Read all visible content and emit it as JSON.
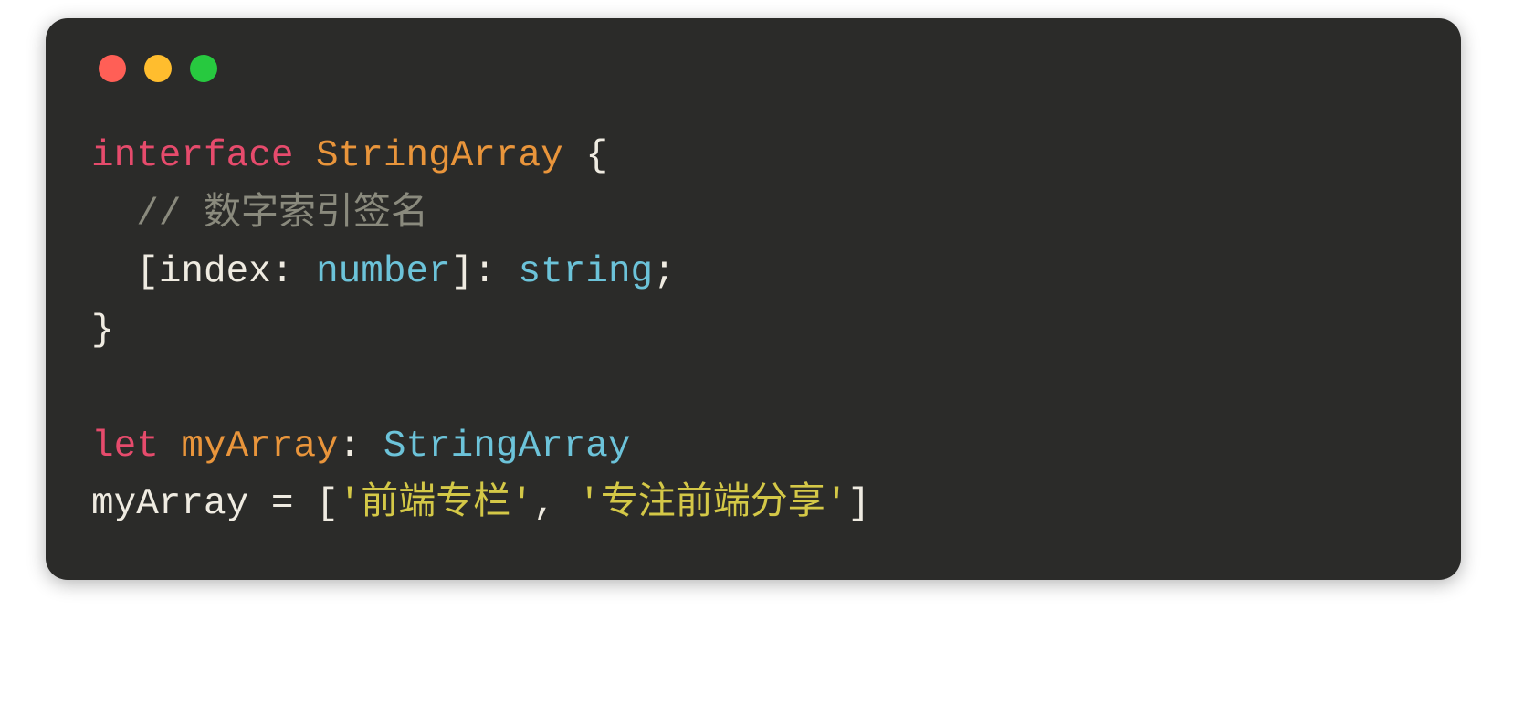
{
  "code": {
    "line1": {
      "keyword": "interface",
      "sp1": " ",
      "class": "StringArray",
      "sp2": " ",
      "brace": "{"
    },
    "line2": {
      "indent": "  ",
      "comment": "// 数字索引签名"
    },
    "line3": {
      "indent": "  ",
      "lbracket": "[",
      "param": "index",
      "colon1": ": ",
      "type1": "number",
      "rbracket": "]",
      "colon2": ": ",
      "type2": "string",
      "semi": ";"
    },
    "line4": {
      "brace": "}"
    },
    "line5": "",
    "line6": {
      "keyword": "let",
      "sp1": " ",
      "var": "myArray",
      "colon": ": ",
      "type": "StringArray"
    },
    "line7": {
      "var": "myArray",
      "sp1": " ",
      "eq": "=",
      "sp2": " ",
      "lbracket": "[",
      "q1a": "'",
      "str1": "前端专栏",
      "q1b": "'",
      "comma": ",",
      "sp3": " ",
      "q2a": "'",
      "str2": "专注前端分享",
      "q2b": "'",
      "rbracket": "]"
    }
  }
}
